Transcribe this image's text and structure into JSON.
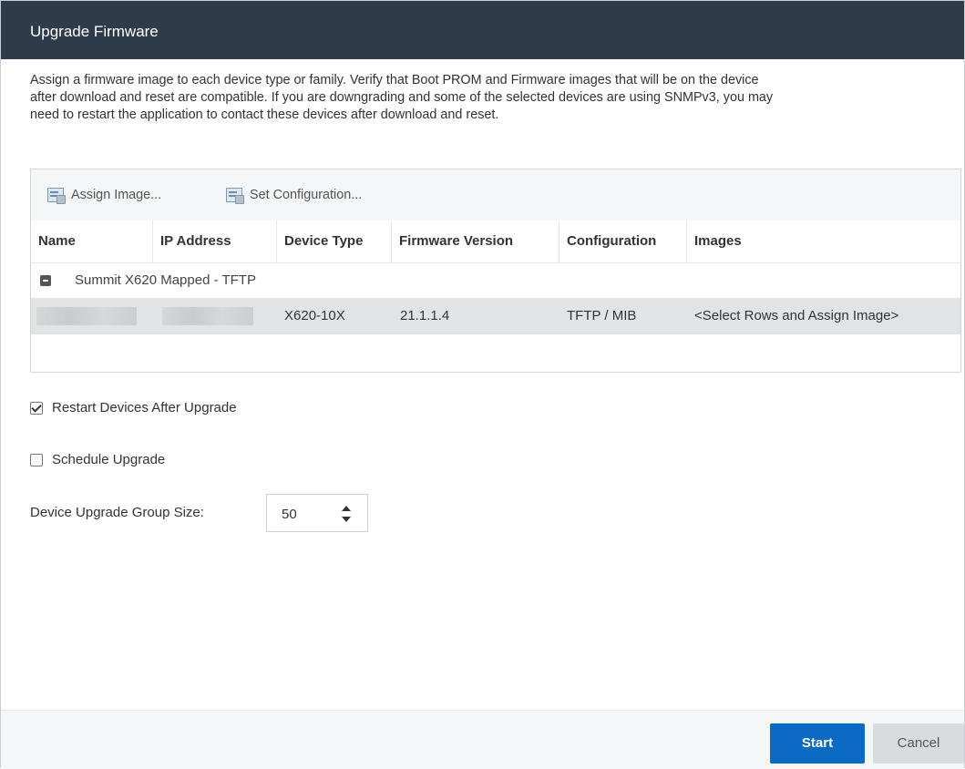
{
  "dialog": {
    "title": "Upgrade Firmware",
    "description": "Assign a firmware image to each device type or family. Verify that Boot PROM and Firmware images that will be on the device after download and reset are compatible. If you are downgrading and some of the selected devices are using SNMPv3, you may need to restart the application to contact these devices after download and reset."
  },
  "toolbar": {
    "assign_image_label": "Assign Image...",
    "set_configuration_label": "Set Configuration..."
  },
  "table": {
    "columns": [
      "Name",
      "IP Address",
      "Device Type",
      "Firmware Version",
      "Configuration",
      "Images"
    ],
    "group": {
      "label": "Summit X620 Mapped - TFTP"
    },
    "rows": [
      {
        "name": "",
        "ip_address": "",
        "device_type": "X620-10X",
        "firmware_version": "21.1.1.4",
        "configuration": "TFTP / MIB",
        "images": "<Select Rows and Assign Image>"
      }
    ]
  },
  "options": {
    "restart_label": "Restart Devices After Upgrade",
    "restart_checked": true,
    "schedule_label": "Schedule Upgrade",
    "schedule_checked": false,
    "group_size_label": "Device Upgrade Group Size:",
    "group_size_value": "50"
  },
  "footer": {
    "start_label": "Start",
    "cancel_label": "Cancel"
  },
  "colors": {
    "titlebar": "#2e3b4b",
    "primary_button": "#0b6ac4",
    "selected_row": "#e1e3e5"
  }
}
